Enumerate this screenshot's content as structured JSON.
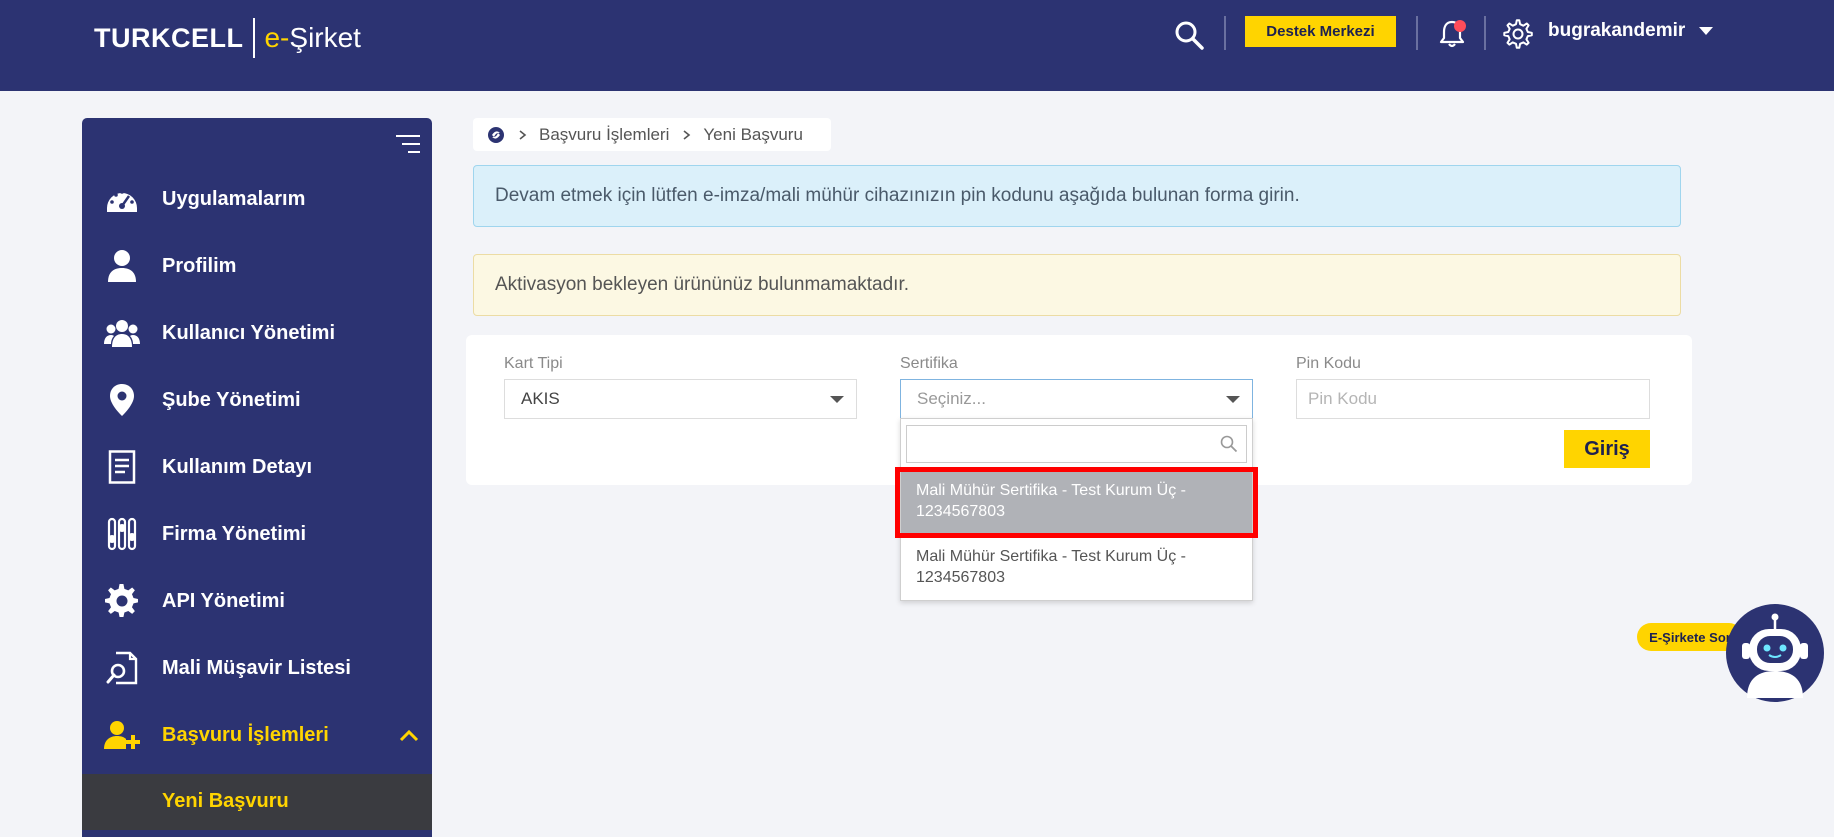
{
  "header": {
    "brand": "TURKCELL",
    "product_e": "e-",
    "product_rest": "Şirket",
    "help_button": "Destek Merkezi",
    "username": "bugrakandemir",
    "colors": {
      "bg": "#2c3372",
      "accent": "#ffd400"
    }
  },
  "sidebar": {
    "items": [
      {
        "label": "Uygulamalarım",
        "icon": "dashboard-icon"
      },
      {
        "label": "Profilim",
        "icon": "user-icon"
      },
      {
        "label": "Kullanıcı Yönetimi",
        "icon": "users-icon"
      },
      {
        "label": "Şube Yönetimi",
        "icon": "map-pin-icon"
      },
      {
        "label": "Kullanım Detayı",
        "icon": "document-icon"
      },
      {
        "label": "Firma Yönetimi",
        "icon": "sliders-icon"
      },
      {
        "label": "API Yönetimi",
        "icon": "gear-icon"
      },
      {
        "label": "Mali Müşavir Listesi",
        "icon": "file-search-icon"
      },
      {
        "label": "Başvuru İşlemleri",
        "icon": "user-add-icon",
        "active": true
      }
    ],
    "subitem": "Yeni Başvuru"
  },
  "breadcrumb": {
    "items": [
      "Başvuru İşlemleri",
      "Yeni Başvuru"
    ]
  },
  "alerts": {
    "info": "Devam etmek için lütfen e-imza/mali mühür cihazınızın pin kodunu aşağıda bulunan forma girin.",
    "warning": "Aktivasyon bekleyen ürününüz bulunmamaktadır."
  },
  "form": {
    "card_type_label": "Kart Tipi",
    "card_type_value": "AKIS",
    "cert_label": "Sertifika",
    "cert_placeholder": "Seçiniz...",
    "pin_label": "Pin Kodu",
    "pin_placeholder": "Pin Kodu",
    "submit": "Giriş"
  },
  "cert_dropdown": {
    "search_value": "",
    "options": [
      {
        "line1": "Mali Mühür Sertifika - Test Kurum Üç -",
        "line2": "1234567803",
        "highlighted": true
      },
      {
        "line1": "Mali Mühür Sertifika - Test Kurum Üç -",
        "line2": "1234567803",
        "highlighted": false
      }
    ]
  },
  "chatbot": {
    "label": "E-Şirkete Sor"
  }
}
